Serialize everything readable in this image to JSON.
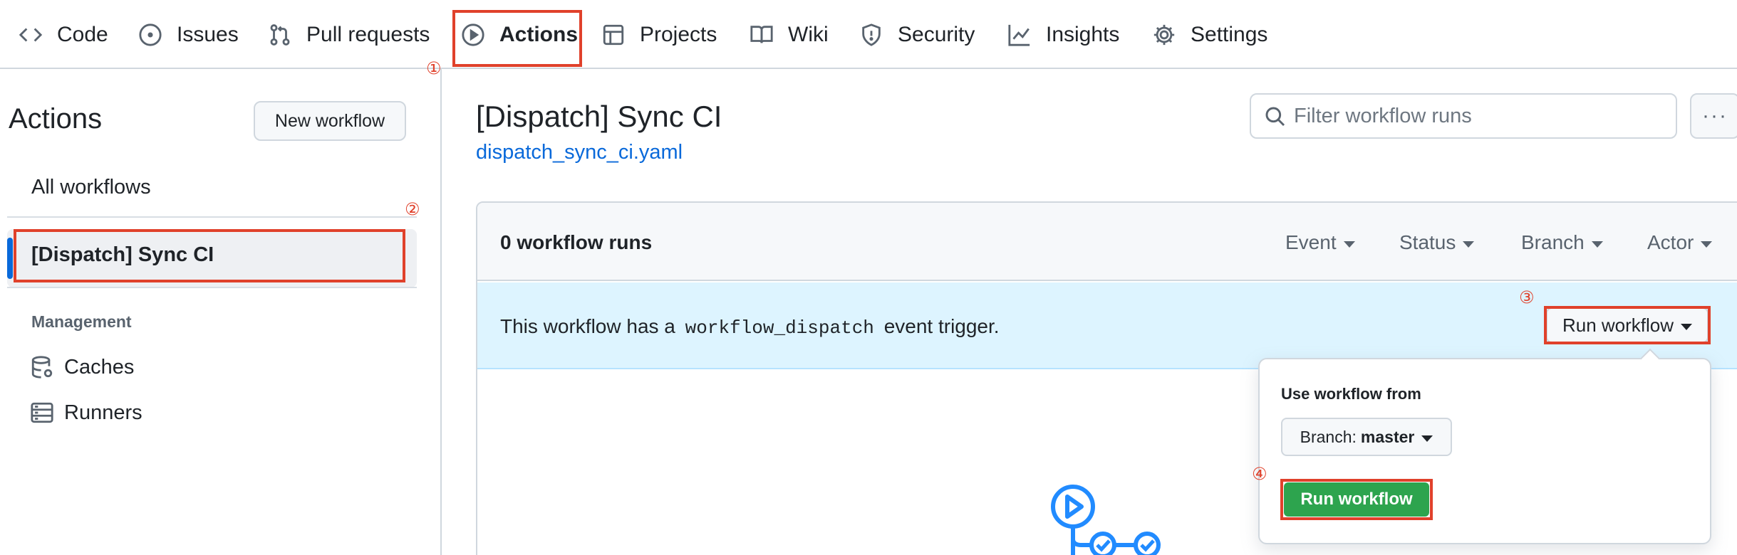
{
  "nav": {
    "tabs": [
      {
        "label": "Code",
        "icon": "code-icon"
      },
      {
        "label": "Issues",
        "icon": "issue-opened-icon"
      },
      {
        "label": "Pull requests",
        "icon": "git-pull-request-icon"
      },
      {
        "label": "Actions",
        "icon": "play-icon",
        "active": true
      },
      {
        "label": "Projects",
        "icon": "table-icon"
      },
      {
        "label": "Wiki",
        "icon": "book-icon"
      },
      {
        "label": "Security",
        "icon": "shield-icon"
      },
      {
        "label": "Insights",
        "icon": "graph-icon"
      },
      {
        "label": "Settings",
        "icon": "gear-icon"
      }
    ]
  },
  "markers": [
    "①",
    "②",
    "③",
    "④"
  ],
  "sidebar": {
    "title": "Actions",
    "new_workflow": "New workflow",
    "all_workflows": "All workflows",
    "selected_workflow": "[Dispatch] Sync CI",
    "management_heading": "Management",
    "management_items": [
      {
        "label": "Caches",
        "icon": "database-icon"
      },
      {
        "label": "Runners",
        "icon": "server-icon"
      }
    ]
  },
  "main": {
    "title": "[Dispatch] Sync CI",
    "file": "dispatch_sync_ci.yaml",
    "filter_placeholder": "Filter workflow runs",
    "kebab": "···",
    "runs_count": "0 workflow runs",
    "filters": [
      "Event",
      "Status",
      "Branch",
      "Actor"
    ],
    "banner_prefix": "This workflow has a",
    "banner_code": "workflow_dispatch",
    "banner_suffix": "event trigger.",
    "run_workflow_button": "Run workflow"
  },
  "dropdown": {
    "label": "Use workflow from",
    "branch_prefix": "Branch:",
    "branch_value": "master",
    "submit": "Run workflow"
  },
  "colors": {
    "highlight_red": "#e0412b",
    "link_blue": "#0969da",
    "banner_bg": "#ddf4ff",
    "primary_green": "#2da44e"
  }
}
